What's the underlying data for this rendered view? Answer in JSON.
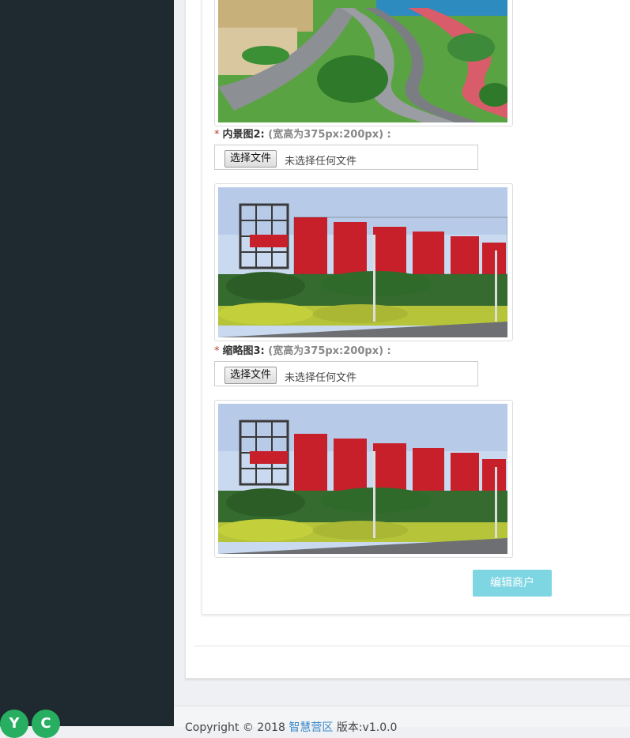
{
  "sidebar": {
    "fab_buttons": [
      {
        "label": "Y",
        "color": "#27ae60"
      },
      {
        "label": "C",
        "color": "#27ae60"
      }
    ]
  },
  "form": {
    "fields": [
      {
        "required_mark": "*",
        "label": "内景图2:",
        "hint": "(宽高为375px:200px) :",
        "file_button": "选择文件",
        "file_status": "未选择任何文件"
      },
      {
        "required_mark": "*",
        "label": "缩略图3:",
        "hint": "(宽高为375px:200px) :",
        "file_button": "选择文件",
        "file_status": "未选择任何文件"
      }
    ],
    "submit_label": "编辑商户"
  },
  "footer": {
    "copyright": "Copyright © 2018",
    "brand": "智慧营区",
    "version": "版本:v1.0.0"
  },
  "colors": {
    "sidebar_bg": "#1f2a30",
    "accent_green": "#27ae60",
    "submit_bg": "#7fd6e3",
    "required_red": "#c0392b",
    "link_blue": "#3a87c8"
  }
}
